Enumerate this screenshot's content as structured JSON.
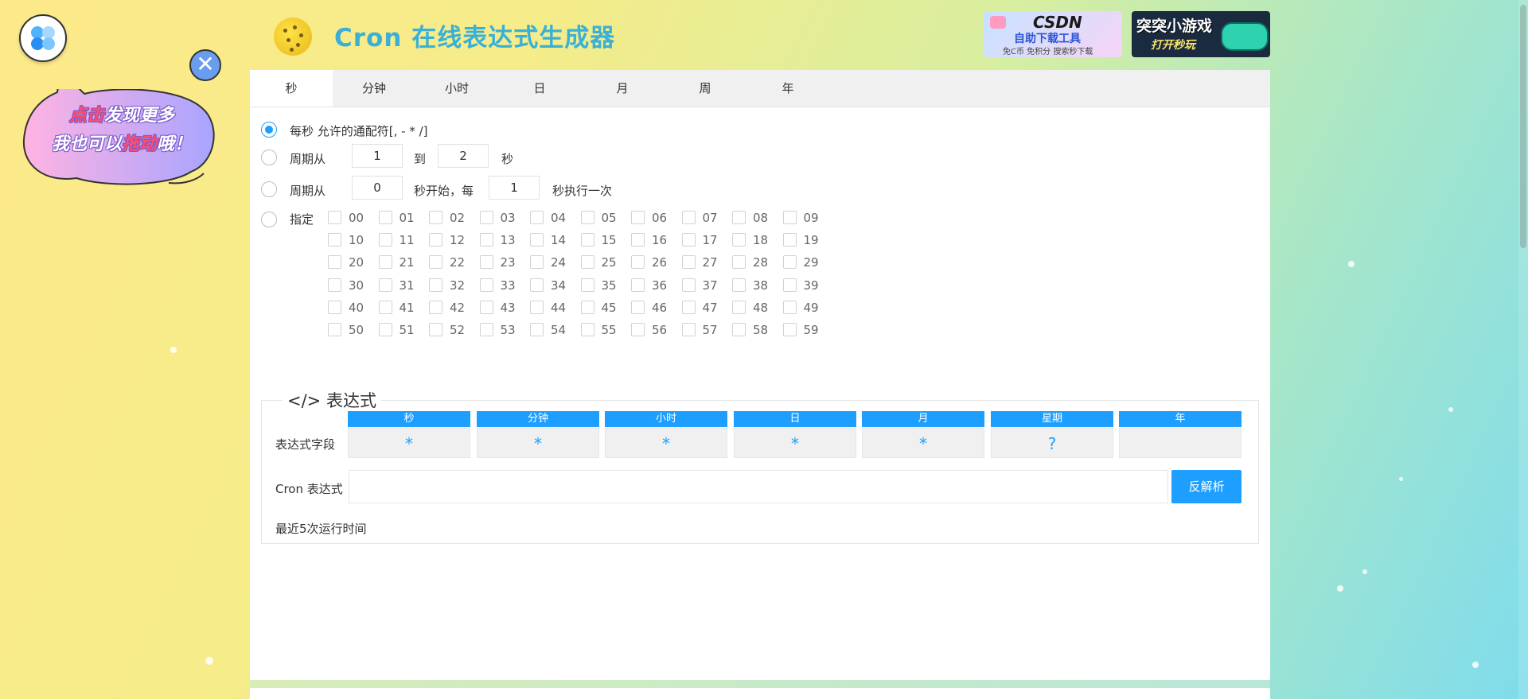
{
  "header": {
    "title": "Cron 在线表达式生成器"
  },
  "ads": [
    {
      "line1": "CSDN",
      "line2": "自助下载工具",
      "line3": "免C币  免积分  搜索秒下载"
    },
    {
      "line1": "突突小游戏",
      "line2": "打开秒玩"
    }
  ],
  "promo": {
    "line1_hl": "点击",
    "line1_rest": "发现更多",
    "line2_a": "我也可以",
    "line2_hl": "拖动",
    "line2_b": "哦！",
    "close_symbol": "✕"
  },
  "tabs": [
    "秒",
    "分钟",
    "小时",
    "日",
    "月",
    "周",
    "年"
  ],
  "active_tab": 0,
  "options": {
    "every": "每秒 允许的通配符[, - * /]",
    "cycle_from": "周期从",
    "cycle_start_value": "1",
    "cycle_to": "到",
    "cycle_end_value": "2",
    "cycle_unit": "秒",
    "interval_from": "周期从",
    "interval_start_value": "0",
    "interval_mid": "秒开始，每",
    "interval_step_value": "1",
    "interval_unit": "秒执行一次",
    "specify": "指定"
  },
  "second_values": [
    "00",
    "01",
    "02",
    "03",
    "04",
    "05",
    "06",
    "07",
    "08",
    "09",
    "10",
    "11",
    "12",
    "13",
    "14",
    "15",
    "16",
    "17",
    "18",
    "19",
    "20",
    "21",
    "22",
    "23",
    "24",
    "25",
    "26",
    "27",
    "28",
    "29",
    "30",
    "31",
    "32",
    "33",
    "34",
    "35",
    "36",
    "37",
    "38",
    "39",
    "40",
    "41",
    "42",
    "43",
    "44",
    "45",
    "46",
    "47",
    "48",
    "49",
    "50",
    "51",
    "52",
    "53",
    "54",
    "55",
    "56",
    "57",
    "58",
    "59"
  ],
  "expression": {
    "legend": "</> 表达式",
    "fields_label": "表达式字段",
    "columns": [
      {
        "label": "秒",
        "value": "*"
      },
      {
        "label": "分钟",
        "value": "*"
      },
      {
        "label": "小时",
        "value": "*"
      },
      {
        "label": "日",
        "value": "*"
      },
      {
        "label": "月",
        "value": "*"
      },
      {
        "label": "星期",
        "value": "?"
      },
      {
        "label": "年",
        "value": ""
      }
    ],
    "cron_label": "Cron 表达式",
    "cron_value": "",
    "parse_button": "反解析",
    "recent_label": "最近5次运行时间"
  },
  "colors": {
    "accent": "#1e9fff",
    "title": "#3bb0d6"
  }
}
